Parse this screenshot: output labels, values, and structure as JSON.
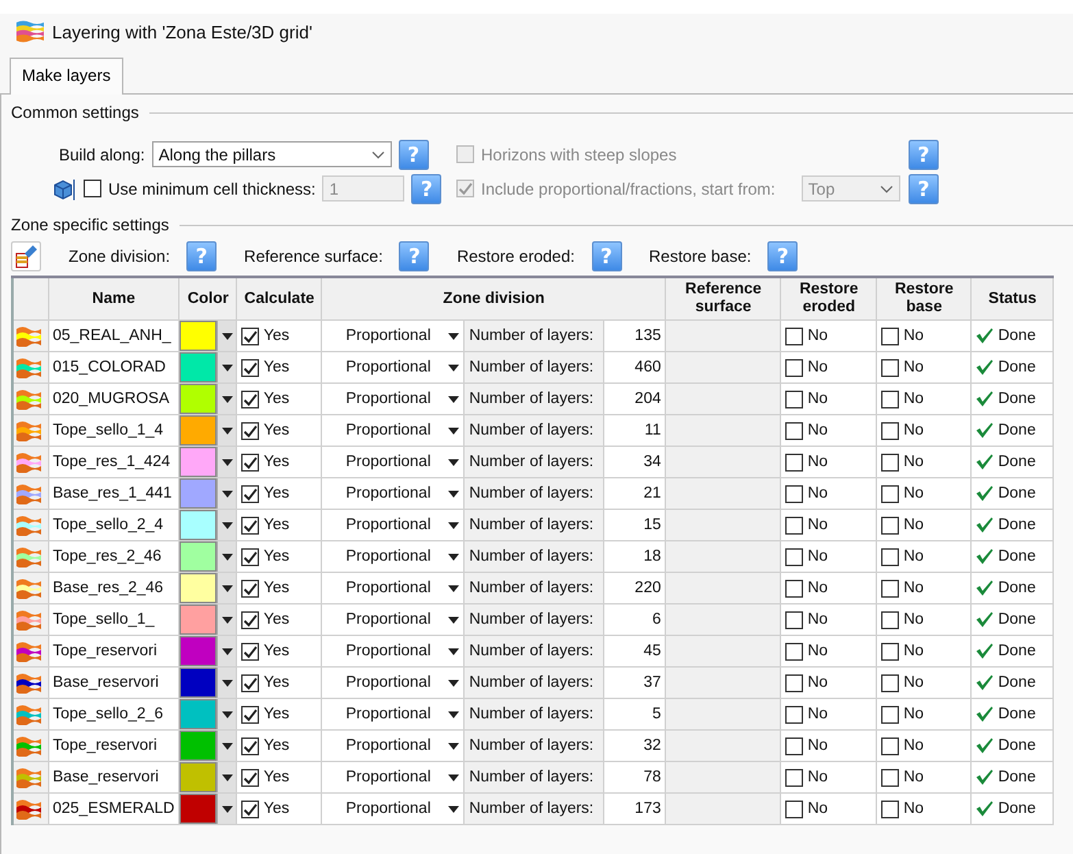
{
  "window": {
    "title": "Layering with 'Zona Este/3D grid'"
  },
  "tabs": [
    {
      "label": "Make layers",
      "selected": true
    }
  ],
  "common_settings": {
    "title": "Common settings",
    "build_along": {
      "label": "Build along:",
      "value": "Along the pillars",
      "help": "?"
    },
    "min_cell_thickness": {
      "label": "Use minimum cell thickness:",
      "checked": false,
      "value": "1",
      "disabled": true,
      "help": "?"
    },
    "steep_slopes": {
      "label": "Horizons with steep slopes",
      "checked": false,
      "disabled": true,
      "help": "?"
    },
    "proportional": {
      "label": "Include proportional/fractions, start from:",
      "checked": true,
      "disabled": true,
      "value": "Top",
      "help": "?"
    }
  },
  "zone_settings": {
    "title": "Zone specific settings",
    "helps": [
      {
        "label": "Zone division:",
        "help": "?"
      },
      {
        "label": "Reference surface:",
        "help": "?"
      },
      {
        "label": "Restore eroded:",
        "help": "?"
      },
      {
        "label": "Restore base:",
        "help": "?"
      }
    ]
  },
  "table": {
    "columns": [
      "Name",
      "Color",
      "Calculate",
      "Zone division",
      "Reference surface",
      "Restore eroded",
      "Restore base",
      "Status"
    ],
    "rows": [
      {
        "name": "05_REAL_ANH_",
        "color": "#ffff00",
        "calculate": true,
        "calculate_label": "Yes",
        "division": "Proportional",
        "division_label": "Number of layers:",
        "layers": "135",
        "restore_eroded": false,
        "eroded_label": "No",
        "restore_base": false,
        "base_label": "No",
        "status": "Done",
        "status_ok": true
      },
      {
        "name": "015_COLORAD",
        "color": "#00e8a8",
        "calculate": true,
        "calculate_label": "Yes",
        "division": "Proportional",
        "division_label": "Number of layers:",
        "layers": "460",
        "restore_eroded": false,
        "eroded_label": "No",
        "restore_base": false,
        "base_label": "No",
        "status": "Done",
        "status_ok": true
      },
      {
        "name": "020_MUGROSA",
        "color": "#b0ff00",
        "calculate": true,
        "calculate_label": "Yes",
        "division": "Proportional",
        "division_label": "Number of layers:",
        "layers": "204",
        "restore_eroded": false,
        "eroded_label": "No",
        "restore_base": false,
        "base_label": "No",
        "status": "Done",
        "status_ok": true
      },
      {
        "name": "Tope_sello_1_4",
        "color": "#ffaa00",
        "calculate": true,
        "calculate_label": "Yes",
        "division": "Proportional",
        "division_label": "Number of layers:",
        "layers": "11",
        "restore_eroded": false,
        "eroded_label": "No",
        "restore_base": false,
        "base_label": "No",
        "status": "Done",
        "status_ok": true
      },
      {
        "name": "Tope_res_1_424",
        "color": "#ffa8f8",
        "calculate": true,
        "calculate_label": "Yes",
        "division": "Proportional",
        "division_label": "Number of layers:",
        "layers": "34",
        "restore_eroded": false,
        "eroded_label": "No",
        "restore_base": false,
        "base_label": "No",
        "status": "Done",
        "status_ok": true
      },
      {
        "name": "Base_res_1_441",
        "color": "#a0a8ff",
        "calculate": true,
        "calculate_label": "Yes",
        "division": "Proportional",
        "division_label": "Number of layers:",
        "layers": "21",
        "restore_eroded": false,
        "eroded_label": "No",
        "restore_base": false,
        "base_label": "No",
        "status": "Done",
        "status_ok": true
      },
      {
        "name": "Tope_sello_2_4",
        "color": "#a8ffff",
        "calculate": true,
        "calculate_label": "Yes",
        "division": "Proportional",
        "division_label": "Number of layers:",
        "layers": "15",
        "restore_eroded": false,
        "eroded_label": "No",
        "restore_base": false,
        "base_label": "No",
        "status": "Done",
        "status_ok": true
      },
      {
        "name": "Tope_res_2_46",
        "color": "#a0ffa0",
        "calculate": true,
        "calculate_label": "Yes",
        "division": "Proportional",
        "division_label": "Number of layers:",
        "layers": "18",
        "restore_eroded": false,
        "eroded_label": "No",
        "restore_base": false,
        "base_label": "No",
        "status": "Done",
        "status_ok": true
      },
      {
        "name": "Base_res_2_46",
        "color": "#ffffa0",
        "calculate": true,
        "calculate_label": "Yes",
        "division": "Proportional",
        "division_label": "Number of layers:",
        "layers": "220",
        "restore_eroded": false,
        "eroded_label": "No",
        "restore_base": false,
        "base_label": "No",
        "status": "Done",
        "status_ok": true
      },
      {
        "name": "Tope_sello_1_",
        "color": "#ffa0a0",
        "calculate": true,
        "calculate_label": "Yes",
        "division": "Proportional",
        "division_label": "Number of layers:",
        "layers": "6",
        "restore_eroded": false,
        "eroded_label": "No",
        "restore_base": false,
        "base_label": "No",
        "status": "Done",
        "status_ok": true
      },
      {
        "name": "Tope_reservori",
        "color": "#c000c0",
        "calculate": true,
        "calculate_label": "Yes",
        "division": "Proportional",
        "division_label": "Number of layers:",
        "layers": "45",
        "restore_eroded": false,
        "eroded_label": "No",
        "restore_base": false,
        "base_label": "No",
        "status": "Done",
        "status_ok": true
      },
      {
        "name": "Base_reservori",
        "color": "#0000c0",
        "calculate": true,
        "calculate_label": "Yes",
        "division": "Proportional",
        "division_label": "Number of layers:",
        "layers": "37",
        "restore_eroded": false,
        "eroded_label": "No",
        "restore_base": false,
        "base_label": "No",
        "status": "Done",
        "status_ok": true
      },
      {
        "name": "Tope_sello_2_6",
        "color": "#00c0c0",
        "calculate": true,
        "calculate_label": "Yes",
        "division": "Proportional",
        "division_label": "Number of layers:",
        "layers": "5",
        "restore_eroded": false,
        "eroded_label": "No",
        "restore_base": false,
        "base_label": "No",
        "status": "Done",
        "status_ok": true
      },
      {
        "name": "Tope_reservori",
        "color": "#00c000",
        "calculate": true,
        "calculate_label": "Yes",
        "division": "Proportional",
        "division_label": "Number of layers:",
        "layers": "32",
        "restore_eroded": false,
        "eroded_label": "No",
        "restore_base": false,
        "base_label": "No",
        "status": "Done",
        "status_ok": true
      },
      {
        "name": "Base_reservori",
        "color": "#c0c000",
        "calculate": true,
        "calculate_label": "Yes",
        "division": "Proportional",
        "division_label": "Number of layers:",
        "layers": "78",
        "restore_eroded": false,
        "eroded_label": "No",
        "restore_base": false,
        "base_label": "No",
        "status": "Done",
        "status_ok": true
      },
      {
        "name": "025_ESMERALD",
        "color": "#c00000",
        "calculate": true,
        "calculate_label": "Yes",
        "division": "Proportional",
        "division_label": "Number of layers:",
        "layers": "173",
        "restore_eroded": false,
        "eroded_label": "No",
        "restore_base": false,
        "base_label": "No",
        "status": "Done",
        "status_ok": true
      }
    ]
  }
}
